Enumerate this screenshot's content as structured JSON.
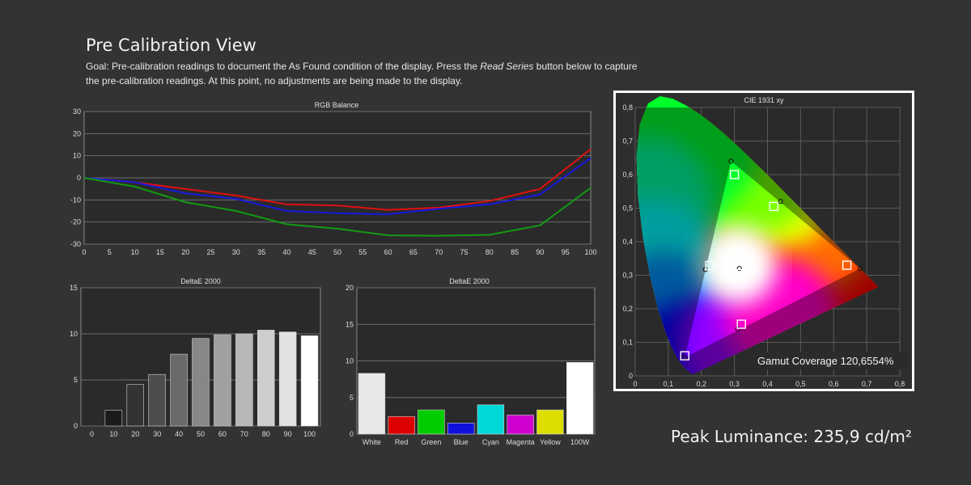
{
  "header": {
    "title": "Pre Calibration View",
    "desc_1": "Goal: Pre-calibration readings to document the As Found condition of the display. Press the ",
    "desc_em": "Read Series",
    "desc_2": " button below to capture the pre-calibration readings. At this point, no adjustments are being made to the display."
  },
  "peak_luminance": "Peak Luminance: 235,9 cd/m²",
  "chart_data": [
    {
      "type": "line",
      "title": "RGB Balance",
      "x": [
        0,
        10,
        20,
        30,
        40,
        50,
        60,
        70,
        80,
        90,
        100
      ],
      "x_ticks": [
        "0",
        "5",
        "10",
        "15",
        "20",
        "25",
        "30",
        "35",
        "40",
        "45",
        "50",
        "55",
        "60",
        "65",
        "70",
        "75",
        "80",
        "85",
        "90",
        "95",
        "100"
      ],
      "y_ticks": [
        "30",
        "20",
        "10",
        "0",
        "-10",
        "-20",
        "-30"
      ],
      "xlim": [
        0,
        100
      ],
      "ylim": [
        -30,
        30
      ],
      "grid": true,
      "series": [
        {
          "color": "#e01010",
          "values": [
            0,
            -2,
            -5,
            -8,
            -12,
            -12.5,
            -14.5,
            -13.5,
            -10.5,
            -5,
            13
          ]
        },
        {
          "color": "#1818e0",
          "values": [
            0,
            -2,
            -7,
            -9.5,
            -15,
            -16,
            -16.5,
            -14,
            -12,
            -7.5,
            9
          ]
        },
        {
          "color": "#129a12",
          "values": [
            0,
            -4,
            -11,
            -15,
            -21,
            -23,
            -26,
            -26.2,
            -25.8,
            -21.5,
            -4.5
          ]
        }
      ]
    },
    {
      "type": "bar",
      "title": "DeltaE 2000",
      "categories": [
        "0",
        "10",
        "20",
        "30",
        "40",
        "50",
        "60",
        "70",
        "80",
        "90",
        "100"
      ],
      "values": [
        0,
        1.7,
        4.5,
        5.6,
        7.8,
        9.5,
        9.9,
        10.0,
        10.4,
        10.2,
        9.8
      ],
      "colors": [
        "#101010",
        "#1a1a1a",
        "#333333",
        "#4d4d4d",
        "#6a6a6a",
        "#878787",
        "#a0a0a0",
        "#b8b8b8",
        "#cecece",
        "#e2e2e2",
        "#ffffff"
      ],
      "y_ticks": [
        "15",
        "10",
        "5",
        "0"
      ],
      "ylim": [
        0,
        15
      ],
      "grid": true
    },
    {
      "type": "bar",
      "title": "DeltaE 2000",
      "categories": [
        "White",
        "Red",
        "Green",
        "Blue",
        "Cyan",
        "Magenta",
        "Yellow",
        "100W"
      ],
      "values": [
        8.3,
        2.4,
        3.3,
        1.5,
        4.0,
        2.6,
        3.3,
        9.8
      ],
      "colors": [
        "#e8e8e8",
        "#dd0000",
        "#00cc00",
        "#1010dd",
        "#00d8d8",
        "#d000d0",
        "#dddd00",
        "#ffffff"
      ],
      "y_ticks": [
        "20",
        "15",
        "10",
        "5",
        "0"
      ],
      "ylim": [
        0,
        20
      ],
      "grid": true
    },
    {
      "type": "scatter",
      "title": "CIE 1931 xy",
      "x_ticks": [
        "0",
        "0,1",
        "0,2",
        "0,3",
        "0,4",
        "0,5",
        "0,6",
        "0,7",
        "0,8"
      ],
      "y_ticks": [
        "0,8",
        "0,7",
        "0,6",
        "0,5",
        "0,4",
        "0,3",
        "0,2",
        "0,1",
        "0"
      ],
      "xlim": [
        0,
        0.8
      ],
      "ylim": [
        0,
        0.8
      ],
      "targets": [
        {
          "x": 0.64,
          "y": 0.33
        },
        {
          "x": 0.3,
          "y": 0.6
        },
        {
          "x": 0.15,
          "y": 0.06
        },
        {
          "x": 0.225,
          "y": 0.329
        },
        {
          "x": 0.321,
          "y": 0.154
        },
        {
          "x": 0.419,
          "y": 0.505
        },
        {
          "x": 0.3127,
          "y": 0.329
        }
      ],
      "measured": [
        {
          "x": 0.68,
          "y": 0.32
        },
        {
          "x": 0.29,
          "y": 0.64
        },
        {
          "x": 0.15,
          "y": 0.055
        },
        {
          "x": 0.212,
          "y": 0.317
        },
        {
          "x": 0.31,
          "y": 0.14
        },
        {
          "x": 0.44,
          "y": 0.52
        },
        {
          "x": 0.315,
          "y": 0.32
        }
      ],
      "gamut_coverage": "Gamut Coverage 120,6554%"
    }
  ]
}
